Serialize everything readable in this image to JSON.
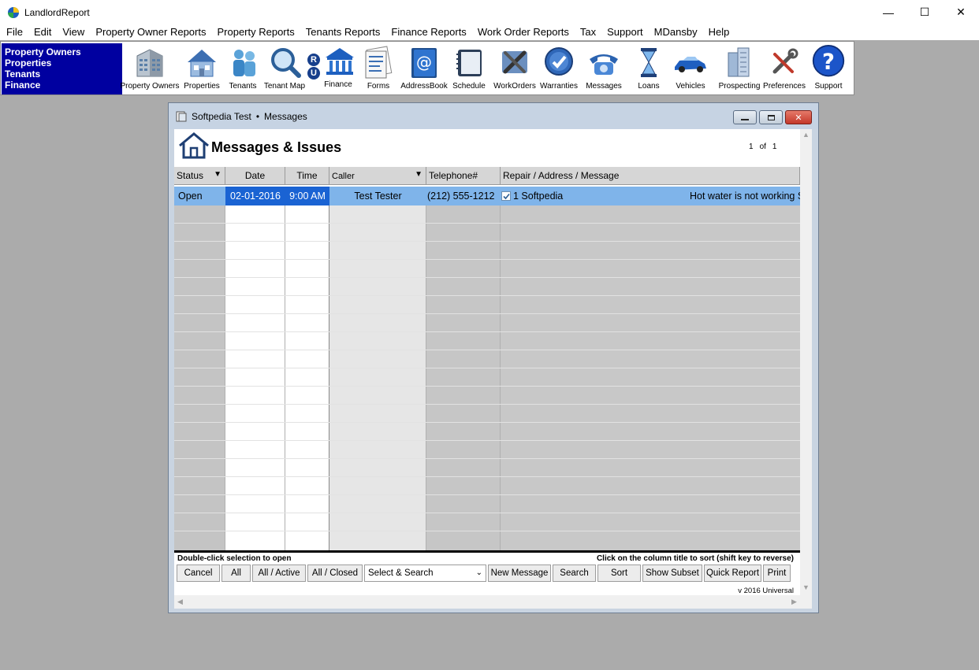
{
  "app": {
    "title": "LandlordReport",
    "controls": {
      "minimize": "—",
      "maximize": "☐",
      "close": "✕"
    }
  },
  "menu": [
    "File",
    "Edit",
    "View",
    "Property Owner Reports",
    "Property Reports",
    "Tenants Reports",
    "Finance Reports",
    "Work Order Reports",
    "Tax",
    "Support",
    "MDansby",
    "Help"
  ],
  "nav_panel": [
    "Property Owners",
    "Properties",
    "Tenants",
    "Finance"
  ],
  "toolbar": [
    {
      "label": "Property Owners",
      "icon": "office-building-icon"
    },
    {
      "label": "Properties",
      "icon": "house-icon"
    },
    {
      "label": "Tenants",
      "icon": "people-icon"
    },
    {
      "label": "Tenant Map",
      "icon": "magnifier-icon"
    },
    {
      "label": "",
      "icon": "ru-badge-icon",
      "badge_top": "R",
      "badge_bottom": "U"
    },
    {
      "label": "Finance",
      "icon": "bank-icon"
    },
    {
      "label": "Forms",
      "icon": "forms-icon"
    },
    {
      "label": "AddressBook",
      "icon": "addressbook-icon"
    },
    {
      "label": "Schedule",
      "icon": "schedule-icon"
    },
    {
      "label": "WorkOrders",
      "icon": "tools-icon"
    },
    {
      "label": "Warranties",
      "icon": "warranty-icon"
    },
    {
      "label": "Messages",
      "icon": "telephone-icon"
    },
    {
      "label": "Loans",
      "icon": "hourglass-icon"
    },
    {
      "label": "Vehicles",
      "icon": "car-icon"
    },
    {
      "label": "Prospecting",
      "icon": "skyscraper-icon"
    },
    {
      "label": "Preferences",
      "icon": "wrench-icon"
    },
    {
      "label": "Support",
      "icon": "help-icon"
    }
  ],
  "child_window": {
    "title_left": "Softpedia Test",
    "title_sep": "•",
    "title_right": "Messages"
  },
  "page": {
    "title": "Messages & Issues",
    "pager": {
      "current": "1",
      "of": "of",
      "total": "1"
    }
  },
  "columns": [
    "Status",
    "Date",
    "Time",
    "Caller",
    "Telephone#",
    "Repair / Address / Message"
  ],
  "rows": [
    {
      "status": "Open",
      "date": "02-01-2016",
      "time": "9:00 AM",
      "caller": "Test Tester",
      "telephone": "(212) 555-1212",
      "repair": "1 Softpedia",
      "message": "Hot water is not working S"
    }
  ],
  "footer": {
    "hint_left": "Double-click selection to open",
    "hint_right": "Click on the column title to sort (shift key to reverse)",
    "buttons": {
      "cancel": "Cancel",
      "all": "All",
      "all_active": "All / Active",
      "all_closed": "All / Closed",
      "select_search": "Select & Search",
      "new_message": "New Message",
      "search": "Search",
      "sort": "Sort",
      "show_subset": "Show Subset",
      "quick_report": "Quick Report",
      "print": "Print"
    },
    "version": "v 2016 Universal"
  }
}
